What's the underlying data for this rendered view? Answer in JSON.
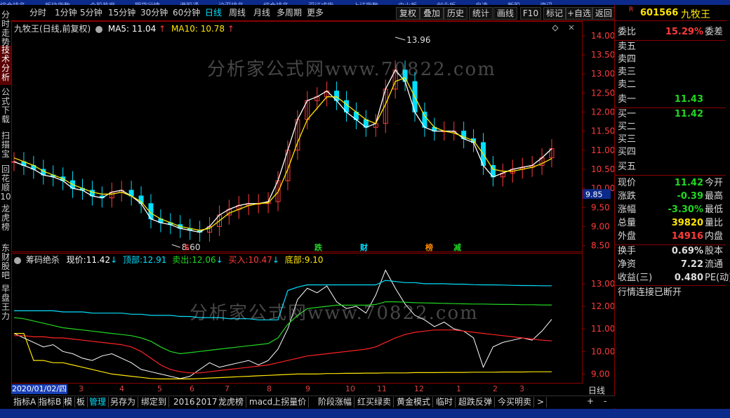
{
  "top_strip_items": [
    "综合排名",
    "板块指数",
    "个股热度",
    "期货行情",
    "港股通",
    "沪深排名",
    "综合排名",
    "深证成指",
    "上证指数",
    "中小板",
    "创业板",
    "自选",
    "新股",
    "资讯"
  ],
  "left_nav": [
    {
      "label": "分时走势",
      "active": false
    },
    {
      "label": "技术分析",
      "active": true
    },
    {
      "label": "公式下载",
      "active": false
    },
    {
      "label": "扫描宝",
      "active": false
    },
    {
      "label": "回花顺10",
      "active": false
    },
    {
      "label": "龙虎榜",
      "active": false
    },
    {
      "label": "东财股吧",
      "active": false
    },
    {
      "label": "早盘王力",
      "active": false
    }
  ],
  "periods": [
    {
      "label": "分时",
      "active": false
    },
    {
      "label": "1分钟",
      "active": false
    },
    {
      "label": "5分钟",
      "active": false
    },
    {
      "label": "15分钟",
      "active": false
    },
    {
      "label": "30分钟",
      "active": false
    },
    {
      "label": "60分钟",
      "active": false
    },
    {
      "label": "日线",
      "active": true
    },
    {
      "label": "周线",
      "active": false
    },
    {
      "label": "月线",
      "active": false
    },
    {
      "label": "多周期",
      "active": false
    },
    {
      "label": "更多",
      "active": false
    }
  ],
  "tools": [
    "复权",
    "叠加",
    "历史",
    "统计",
    "画线",
    "F10",
    "标记",
    "+自选",
    "返回"
  ],
  "main_legend": {
    "name": "九牧王(日线,前复权)",
    "ma5_label": "MA5:",
    "ma5": "11.04",
    "ma10_label": "MA10:",
    "ma10": "10.78"
  },
  "sub_legend": {
    "name": "筹码绝杀",
    "cur_label": "现价:",
    "cur": "11.42",
    "top_label": "顶部:",
    "top": "12.91",
    "sell_label": "卖出:",
    "sell": "12.06",
    "buy_label": "买入:",
    "buy": "10.47",
    "bottom_label": "底部:",
    "bottom": "9.10"
  },
  "main_annotations": {
    "high": "13.96",
    "low": "8.60",
    "current_price_tag": "9.85"
  },
  "signal_marks": [
    "S",
    "跌",
    "财",
    "榜",
    "减"
  ],
  "watermark": "分析家公式网www.70822.com",
  "main_yticks": [
    "14.00",
    "13.50",
    "13.00",
    "12.50",
    "12.00",
    "11.50",
    "11.00",
    "10.50",
    "10.00",
    "9.50",
    "9.00",
    "8.50"
  ],
  "sub_yticks": [
    "13.00",
    "12.00",
    "11.00",
    "10.00",
    "9.00"
  ],
  "x_ticks": [
    "3",
    "4",
    "5",
    "6",
    "7",
    "8",
    "9",
    "10",
    "11",
    "12",
    "1",
    "2",
    "3"
  ],
  "start_date": "2020/01/02/四",
  "period_label": "日线",
  "stock": {
    "code": "601566",
    "name": "九牧王"
  },
  "quote_rows": {
    "weibi_label": "委比",
    "weibi": "15.29%",
    "weicha_label": "委差",
    "sell5": "卖五",
    "sell4": "卖四",
    "sell3": "卖三",
    "sell2": "卖二",
    "sell1": "卖一",
    "sell1_price": "11.43",
    "buy1": "买一",
    "buy1_price": "11.42",
    "buy2": "买二",
    "buy3": "买三",
    "buy4": "买四",
    "buy5": "买五",
    "xianjia_label": "现价",
    "xianjia": "11.42",
    "jinkai_label": "今开",
    "zhangdie_label": "涨跌",
    "zhangdie": "-0.39",
    "zuigao_label": "最高",
    "zhangfu_label": "涨幅",
    "zhangfu": "-3.30%",
    "zuidi_label": "最低",
    "zongliang_label": "总量",
    "zongliang": "39820",
    "liangbi_label": "量比",
    "waipan_label": "外盘",
    "waipan": "14916",
    "neipan_label": "内盘",
    "huanshou_label": "换手",
    "huanshou": "0.69%",
    "guben_label": "股本",
    "jingzi_label": "净资",
    "jingzi": "7.22",
    "liutong_label": "流通",
    "shouyi_label": "收益(三)",
    "shouyi": "0.480",
    "pe_label": "PE(动)",
    "status": "行情连接已断开"
  },
  "bottom_tabs": [
    {
      "label": "指标A",
      "active": false
    },
    {
      "label": "指标B",
      "active": false
    },
    {
      "label": "模",
      "active": false
    },
    {
      "label": "板",
      "active": false
    },
    {
      "label": "管理",
      "active": true
    },
    {
      "label": "另存为",
      "active": false
    },
    {
      "label": "绑定到",
      "active": false
    },
    {
      "label": "2016",
      "active": false
    },
    {
      "label": "2017",
      "active": false
    },
    {
      "label": "龙虎榜",
      "active": false
    },
    {
      "label": "macd上拐量价",
      "active": false
    },
    {
      "label": "阶段涨幅",
      "active": false
    },
    {
      "label": "红买绿卖",
      "active": false
    },
    {
      "label": "黄金模式",
      "active": false
    },
    {
      "label": "临时",
      "active": false
    },
    {
      "label": "超跌反弹",
      "active": false
    },
    {
      "label": "今买明卖",
      "active": false
    },
    {
      "label": ">",
      "active": false
    }
  ],
  "colors": {
    "up": "#ff3b3b",
    "down": "#00e0ff",
    "ma5": "#ffffff",
    "ma10": "#ffe600",
    "frame": "#8a0000",
    "green": "#22d622",
    "yellow": "#ffe600"
  },
  "chart_data": {
    "type": "line",
    "series": [
      {
        "name": "MA5",
        "values": [
          10.7,
          10.6,
          10.5,
          10.35,
          10.3,
          10.2,
          10.0,
          9.95,
          9.8,
          9.75,
          9.9,
          9.95,
          9.8,
          9.6,
          9.2,
          9.1,
          9.05,
          8.95,
          8.9,
          8.85,
          9.0,
          9.3,
          9.45,
          9.55,
          9.6,
          9.6,
          9.65,
          10.2,
          11.0,
          11.8,
          12.3,
          12.4,
          12.55,
          12.3,
          12.0,
          11.8,
          11.6,
          11.7,
          12.6,
          13.1,
          12.8,
          12.0,
          11.6,
          11.5,
          11.5,
          11.5,
          11.3,
          11.2,
          10.6,
          10.3,
          10.4,
          10.5,
          10.55,
          10.6,
          10.8,
          11.04
        ]
      },
      {
        "name": "MA10",
        "values": [
          10.8,
          10.7,
          10.6,
          10.45,
          10.35,
          10.25,
          10.1,
          10.0,
          9.9,
          9.85,
          9.85,
          9.9,
          9.8,
          9.65,
          9.35,
          9.2,
          9.1,
          9.0,
          8.95,
          8.9,
          8.95,
          9.15,
          9.35,
          9.45,
          9.55,
          9.6,
          9.62,
          9.9,
          10.5,
          11.2,
          11.8,
          12.1,
          12.4,
          12.4,
          12.2,
          12.0,
          11.8,
          11.7,
          12.2,
          12.8,
          12.9,
          12.4,
          11.9,
          11.6,
          11.5,
          11.45,
          11.35,
          11.25,
          10.9,
          10.5,
          10.45,
          10.45,
          10.5,
          10.55,
          10.65,
          10.78
        ]
      }
    ],
    "annotated_high": 13.96,
    "annotated_low": 8.6,
    "ylim": [
      8.4,
      14.2
    ],
    "sub_chart": {
      "ylim": [
        8.7,
        13.9
      ],
      "series": [
        {
          "name": "现价",
          "values": [
            10.8,
            10.6,
            10.4,
            10.2,
            10.3,
            10.0,
            9.9,
            9.7,
            9.6,
            9.8,
            9.9,
            9.7,
            9.5,
            9.2,
            9.1,
            9.0,
            8.9,
            8.8,
            8.9,
            9.2,
            9.5,
            9.3,
            9.4,
            9.5,
            9.6,
            9.4,
            9.6,
            10.1,
            11.0,
            12.3,
            12.8,
            12.6,
            12.9,
            12.2,
            11.9,
            12.0,
            11.7,
            12.5,
            13.6,
            12.8,
            12.1,
            11.6,
            11.4,
            11.1,
            11.3,
            11.0,
            10.9,
            10.6,
            9.3,
            10.2,
            10.4,
            10.5,
            10.6,
            10.5,
            10.9,
            11.42
          ]
        },
        {
          "name": "顶部",
          "values": [
            11.8,
            11.8,
            11.8,
            11.8,
            11.8,
            11.75,
            11.75,
            11.75,
            11.7,
            11.7,
            11.7,
            11.7,
            11.65,
            11.65,
            11.6,
            11.6,
            11.6,
            11.55,
            11.55,
            11.5,
            11.5,
            11.5,
            11.45,
            11.45,
            11.45,
            11.4,
            11.4,
            11.4,
            12.7,
            12.85,
            12.95,
            12.95,
            12.95,
            12.95,
            12.95,
            12.95,
            12.95,
            12.95,
            13.15,
            13.1,
            13.05,
            13.05,
            13.0,
            13.0,
            13.0,
            12.98,
            12.98,
            12.96,
            12.95,
            12.95,
            12.94,
            12.93,
            12.92,
            12.92,
            12.91,
            12.91
          ]
        },
        {
          "name": "卖出",
          "values": [
            11.5,
            11.45,
            11.35,
            11.25,
            11.15,
            11.05,
            11.0,
            10.95,
            10.9,
            10.85,
            10.8,
            10.75,
            10.7,
            10.6,
            10.45,
            10.2,
            10.0,
            9.9,
            9.95,
            10.0,
            10.05,
            10.1,
            10.15,
            10.2,
            10.25,
            10.3,
            10.35,
            10.6,
            11.2,
            11.6,
            11.9,
            11.95,
            12.0,
            12.05,
            12.05,
            12.05,
            12.05,
            12.08,
            12.2,
            12.2,
            12.18,
            12.16,
            12.15,
            12.14,
            12.13,
            12.12,
            12.11,
            12.1,
            12.1,
            12.09,
            12.08,
            12.08,
            12.07,
            12.07,
            12.06,
            12.06
          ]
        },
        {
          "name": "买入",
          "values": [
            10.7,
            10.7,
            10.65,
            10.65,
            10.6,
            10.6,
            10.55,
            10.5,
            10.45,
            10.4,
            10.35,
            10.3,
            10.2,
            10.0,
            9.7,
            9.4,
            9.2,
            9.1,
            9.05,
            9.05,
            9.1,
            9.15,
            9.2,
            9.25,
            9.3,
            9.35,
            9.4,
            9.5,
            9.6,
            9.7,
            9.8,
            9.85,
            9.9,
            9.95,
            10.0,
            10.05,
            10.1,
            10.2,
            10.4,
            10.6,
            10.75,
            10.85,
            10.9,
            10.95,
            10.95,
            10.95,
            10.9,
            10.85,
            10.8,
            10.75,
            10.7,
            10.65,
            10.6,
            10.55,
            10.5,
            10.47
          ]
        },
        {
          "name": "底部",
          "values": [
            10.8,
            10.8,
            9.6,
            9.6,
            9.5,
            9.5,
            9.4,
            9.3,
            9.2,
            9.1,
            9.0,
            8.95,
            8.9,
            8.85,
            8.8,
            8.78,
            8.78,
            8.78,
            8.78,
            8.8,
            8.82,
            8.84,
            8.86,
            8.88,
            8.9,
            8.92,
            8.94,
            8.96,
            8.98,
            9.0,
            9.0,
            9.0,
            9.02,
            9.02,
            9.03,
            9.03,
            9.04,
            9.04,
            9.05,
            9.05,
            9.05,
            9.06,
            9.06,
            9.06,
            9.07,
            9.07,
            9.07,
            9.08,
            9.08,
            9.08,
            9.09,
            9.09,
            9.09,
            9.1,
            9.1,
            9.1
          ]
        }
      ]
    }
  }
}
